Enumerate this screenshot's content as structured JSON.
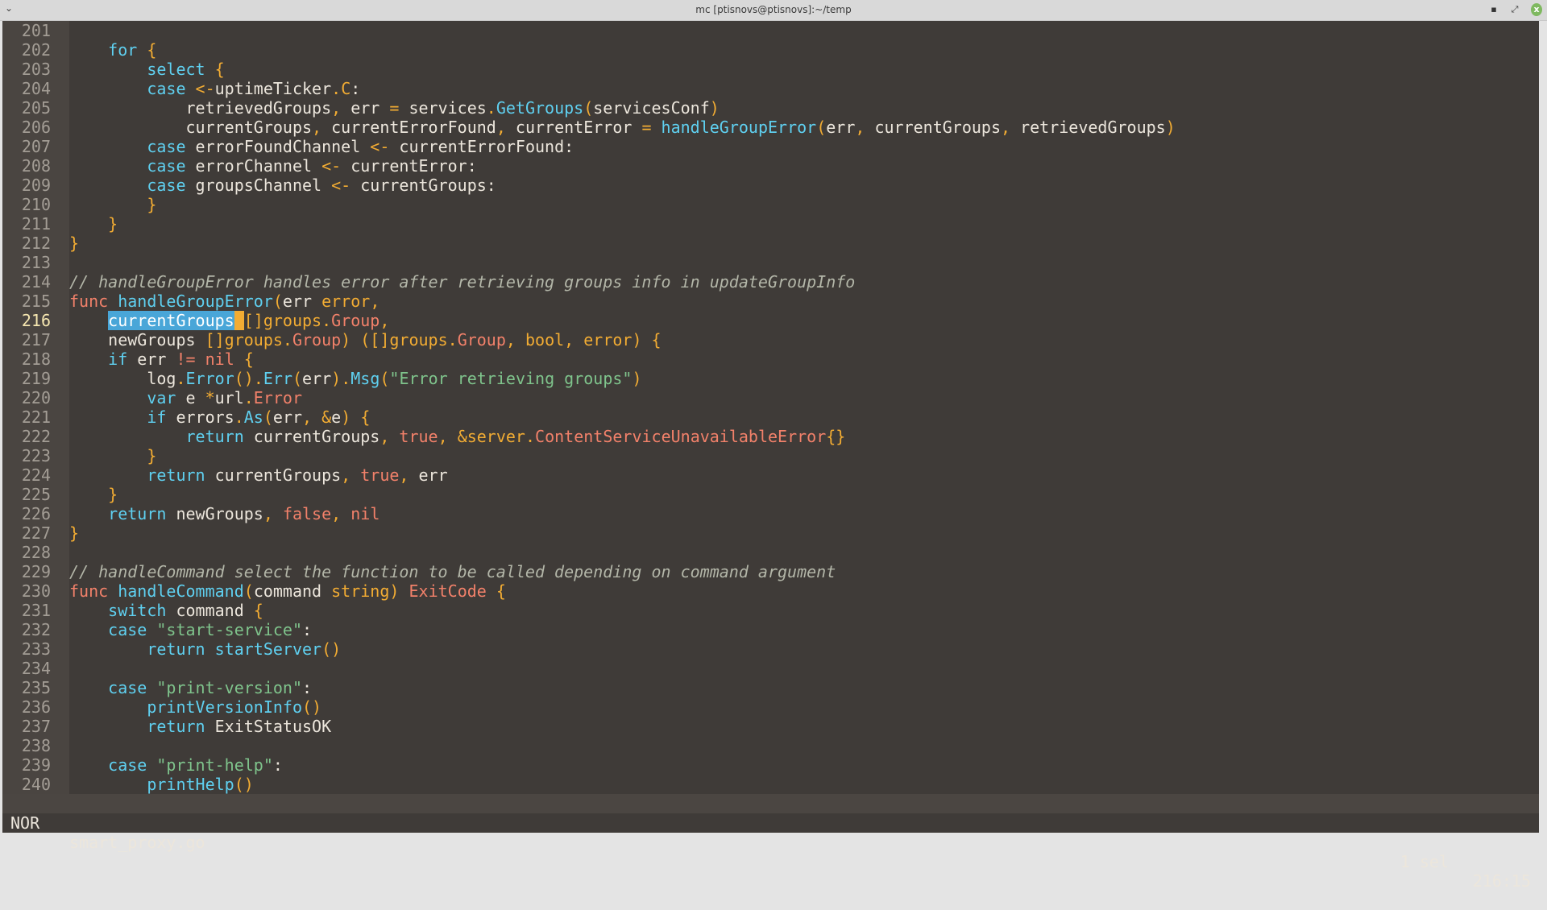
{
  "window": {
    "title": "mc [ptisnovs@ptisnovs]:~/temp",
    "menu_icon": "chevron-down-icon",
    "minimize": "▪",
    "maximize": "⤢",
    "close": "x"
  },
  "editor": {
    "first_line": 201,
    "current_line": 216,
    "lines": [
      [],
      [
        [
          "t",
          "    "
        ],
        [
          "k",
          "for"
        ],
        [
          "t",
          " "
        ],
        [
          "o",
          "{"
        ]
      ],
      [
        [
          "t",
          "        "
        ],
        [
          "k",
          "select"
        ],
        [
          "t",
          " "
        ],
        [
          "o",
          "{"
        ]
      ],
      [
        [
          "t",
          "        "
        ],
        [
          "k",
          "case"
        ],
        [
          "t",
          " "
        ],
        [
          "o",
          "<-"
        ],
        [
          "t",
          "uptimeTicker"
        ],
        [
          "o",
          "."
        ],
        [
          "o",
          "C"
        ],
        [
          "t",
          ":"
        ]
      ],
      [
        [
          "t",
          "            retrievedGroups"
        ],
        [
          "o",
          ","
        ],
        [
          "t",
          " err "
        ],
        [
          "o",
          "="
        ],
        [
          "t",
          " services"
        ],
        [
          "o",
          "."
        ],
        [
          "k",
          "GetGroups"
        ],
        [
          "o",
          "("
        ],
        [
          "t",
          "servicesConf"
        ],
        [
          "o",
          ")"
        ]
      ],
      [
        [
          "t",
          "            currentGroups"
        ],
        [
          "o",
          ","
        ],
        [
          "t",
          " currentErrorFound"
        ],
        [
          "o",
          ","
        ],
        [
          "t",
          " currentError "
        ],
        [
          "o",
          "="
        ],
        [
          "t",
          " "
        ],
        [
          "k",
          "handleGroupError"
        ],
        [
          "o",
          "("
        ],
        [
          "t",
          "err"
        ],
        [
          "o",
          ","
        ],
        [
          "t",
          " currentGroups"
        ],
        [
          "o",
          ","
        ],
        [
          "t",
          " retrievedGroups"
        ],
        [
          "o",
          ")"
        ]
      ],
      [
        [
          "t",
          "        "
        ],
        [
          "k",
          "case"
        ],
        [
          "t",
          " errorFoundChannel "
        ],
        [
          "o",
          "<-"
        ],
        [
          "t",
          " currentErrorFound:"
        ]
      ],
      [
        [
          "t",
          "        "
        ],
        [
          "k",
          "case"
        ],
        [
          "t",
          " errorChannel "
        ],
        [
          "o",
          "<-"
        ],
        [
          "t",
          " currentError:"
        ]
      ],
      [
        [
          "t",
          "        "
        ],
        [
          "k",
          "case"
        ],
        [
          "t",
          " groupsChannel "
        ],
        [
          "o",
          "<-"
        ],
        [
          "t",
          " currentGroups:"
        ]
      ],
      [
        [
          "t",
          "        "
        ],
        [
          "o",
          "}"
        ]
      ],
      [
        [
          "t",
          "    "
        ],
        [
          "o",
          "}"
        ]
      ],
      [
        [
          "o",
          "}"
        ]
      ],
      [],
      [
        [
          "c",
          "// handleGroupError handles error after retrieving groups info in updateGroupInfo"
        ]
      ],
      [
        [
          "r",
          "func"
        ],
        [
          "t",
          " "
        ],
        [
          "k",
          "handleGroupError"
        ],
        [
          "o",
          "("
        ],
        [
          "t",
          "err "
        ],
        [
          "o",
          "error"
        ],
        [
          "o",
          ","
        ]
      ],
      [
        [
          "t",
          "    "
        ],
        [
          "sel",
          "currentGroups"
        ],
        [
          "cur",
          " "
        ],
        [
          "o",
          "[]groups"
        ],
        [
          "o",
          "."
        ],
        [
          "r",
          "Group"
        ],
        [
          "o",
          ","
        ]
      ],
      [
        [
          "t",
          "    newGroups "
        ],
        [
          "o",
          "[]groups"
        ],
        [
          "o",
          "."
        ],
        [
          "r",
          "Group"
        ],
        [
          "o",
          ")"
        ],
        [
          "t",
          " "
        ],
        [
          "o",
          "([]groups"
        ],
        [
          "o",
          "."
        ],
        [
          "r",
          "Group"
        ],
        [
          "o",
          ", bool, error) {"
        ]
      ],
      [
        [
          "t",
          "    "
        ],
        [
          "k",
          "if"
        ],
        [
          "t",
          " err "
        ],
        [
          "r",
          "!="
        ],
        [
          "t",
          " "
        ],
        [
          "r",
          "nil"
        ],
        [
          "t",
          " "
        ],
        [
          "o",
          "{"
        ]
      ],
      [
        [
          "t",
          "        log"
        ],
        [
          "o",
          "."
        ],
        [
          "k",
          "Error"
        ],
        [
          "o",
          "()"
        ],
        [
          "o",
          "."
        ],
        [
          "k",
          "Err"
        ],
        [
          "o",
          "("
        ],
        [
          "t",
          "err"
        ],
        [
          "o",
          ")"
        ],
        [
          "o",
          "."
        ],
        [
          "k",
          "Msg"
        ],
        [
          "o",
          "("
        ],
        [
          "s",
          "\"Error retrieving groups\""
        ],
        [
          "o",
          ")"
        ]
      ],
      [
        [
          "t",
          "        "
        ],
        [
          "k",
          "var"
        ],
        [
          "t",
          " e "
        ],
        [
          "o",
          "*"
        ],
        [
          "t",
          "url"
        ],
        [
          "o",
          "."
        ],
        [
          "r",
          "Error"
        ]
      ],
      [
        [
          "t",
          "        "
        ],
        [
          "k",
          "if"
        ],
        [
          "t",
          " errors"
        ],
        [
          "o",
          "."
        ],
        [
          "k",
          "As"
        ],
        [
          "o",
          "("
        ],
        [
          "t",
          "err"
        ],
        [
          "o",
          ","
        ],
        [
          "t",
          " "
        ],
        [
          "o",
          "&"
        ],
        [
          "t",
          "e"
        ],
        [
          "o",
          ")"
        ],
        [
          "t",
          " "
        ],
        [
          "o",
          "{"
        ]
      ],
      [
        [
          "t",
          "            "
        ],
        [
          "k",
          "return"
        ],
        [
          "t",
          " currentGroups"
        ],
        [
          "o",
          ","
        ],
        [
          "t",
          " "
        ],
        [
          "r",
          "true"
        ],
        [
          "o",
          ","
        ],
        [
          "t",
          " "
        ],
        [
          "o",
          "&server"
        ],
        [
          "o",
          "."
        ],
        [
          "r",
          "ContentServiceUnavailableError"
        ],
        [
          "o",
          "{}"
        ]
      ],
      [
        [
          "t",
          "        "
        ],
        [
          "o",
          "}"
        ]
      ],
      [
        [
          "t",
          "        "
        ],
        [
          "k",
          "return"
        ],
        [
          "t",
          " currentGroups"
        ],
        [
          "o",
          ","
        ],
        [
          "t",
          " "
        ],
        [
          "r",
          "true"
        ],
        [
          "o",
          ","
        ],
        [
          "t",
          " err"
        ]
      ],
      [
        [
          "t",
          "    "
        ],
        [
          "o",
          "}"
        ]
      ],
      [
        [
          "t",
          "    "
        ],
        [
          "k",
          "return"
        ],
        [
          "t",
          " newGroups"
        ],
        [
          "o",
          ","
        ],
        [
          "t",
          " "
        ],
        [
          "r",
          "false"
        ],
        [
          "o",
          ","
        ],
        [
          "t",
          " "
        ],
        [
          "r",
          "nil"
        ]
      ],
      [
        [
          "o",
          "}"
        ]
      ],
      [],
      [
        [
          "c",
          "// handleCommand select the function to be called depending on command argument"
        ]
      ],
      [
        [
          "r",
          "func"
        ],
        [
          "t",
          " "
        ],
        [
          "k",
          "handleCommand"
        ],
        [
          "o",
          "("
        ],
        [
          "t",
          "command "
        ],
        [
          "o",
          "string"
        ],
        [
          "o",
          ")"
        ],
        [
          "t",
          " "
        ],
        [
          "r",
          "ExitCode"
        ],
        [
          "t",
          " "
        ],
        [
          "o",
          "{"
        ]
      ],
      [
        [
          "t",
          "    "
        ],
        [
          "k",
          "switch"
        ],
        [
          "t",
          " command "
        ],
        [
          "o",
          "{"
        ]
      ],
      [
        [
          "t",
          "    "
        ],
        [
          "k",
          "case"
        ],
        [
          "t",
          " "
        ],
        [
          "s",
          "\"start-service\""
        ],
        [
          "t",
          ":"
        ]
      ],
      [
        [
          "t",
          "        "
        ],
        [
          "k",
          "return"
        ],
        [
          "t",
          " "
        ],
        [
          "k",
          "startServer"
        ],
        [
          "o",
          "()"
        ]
      ],
      [],
      [
        [
          "t",
          "    "
        ],
        [
          "k",
          "case"
        ],
        [
          "t",
          " "
        ],
        [
          "s",
          "\"print-version\""
        ],
        [
          "t",
          ":"
        ]
      ],
      [
        [
          "t",
          "        "
        ],
        [
          "k",
          "printVersionInfo"
        ],
        [
          "o",
          "()"
        ]
      ],
      [
        [
          "t",
          "        "
        ],
        [
          "k",
          "return"
        ],
        [
          "t",
          " ExitStatusOK"
        ]
      ],
      [],
      [
        [
          "t",
          "    "
        ],
        [
          "k",
          "case"
        ],
        [
          "t",
          " "
        ],
        [
          "s",
          "\"print-help\""
        ],
        [
          "t",
          ":"
        ]
      ],
      [
        [
          "t",
          "        "
        ],
        [
          "k",
          "printHelp"
        ],
        [
          "o",
          "()"
        ]
      ]
    ]
  },
  "statusbar": {
    "mode": "NOR",
    "filename": "smart_proxy.go",
    "selections": "1 sel",
    "position": "216:15"
  },
  "colors": {
    "background": "#3f3b38",
    "gutter": "#4a4541",
    "keyword": "#5fd0f0",
    "punct": "#f2ac33",
    "constant": "#f2816a",
    "string": "#7fc48c",
    "selection": "#49a6d8"
  }
}
